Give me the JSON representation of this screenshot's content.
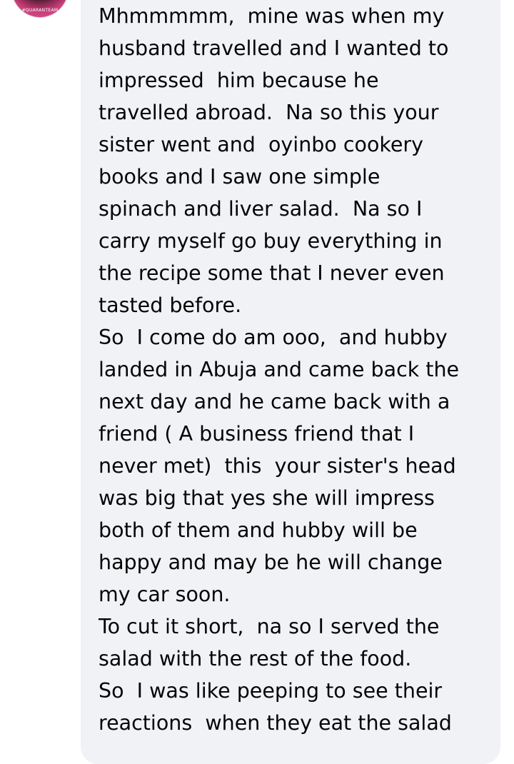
{
  "comment": {
    "avatar_badge": "#QUARANTEAM",
    "text": "Mhmmmmm,  mine was when my\nhusband travelled and I wanted to\nimpressed  him because he\ntravelled abroad.  Na so this your\nsister went and  oyinbo cookery\nbooks and I saw one simple\nspinach and liver salad.  Na so I\ncarry myself go buy everything in\nthe recipe some that I never even\ntasted before.\nSo  I come do am ooo,  and hubby\nlanded in Abuja and came back the\nnext day and he came back with a\nfriend ( A business friend that I\nnever met)  this  your sister's head\nwas big that yes she will impress\nboth of them and hubby will be\nhappy and may be he will change\nmy car soon.\nTo cut it short,  na so I served the\nsalad with the rest of the food.\nSo  I was like peeping to see their\nreactions  when they eat the salad"
  },
  "colors": {
    "bubble_background": "#f0f2f5",
    "text": "#050505",
    "avatar_ring": "#e0528d"
  }
}
